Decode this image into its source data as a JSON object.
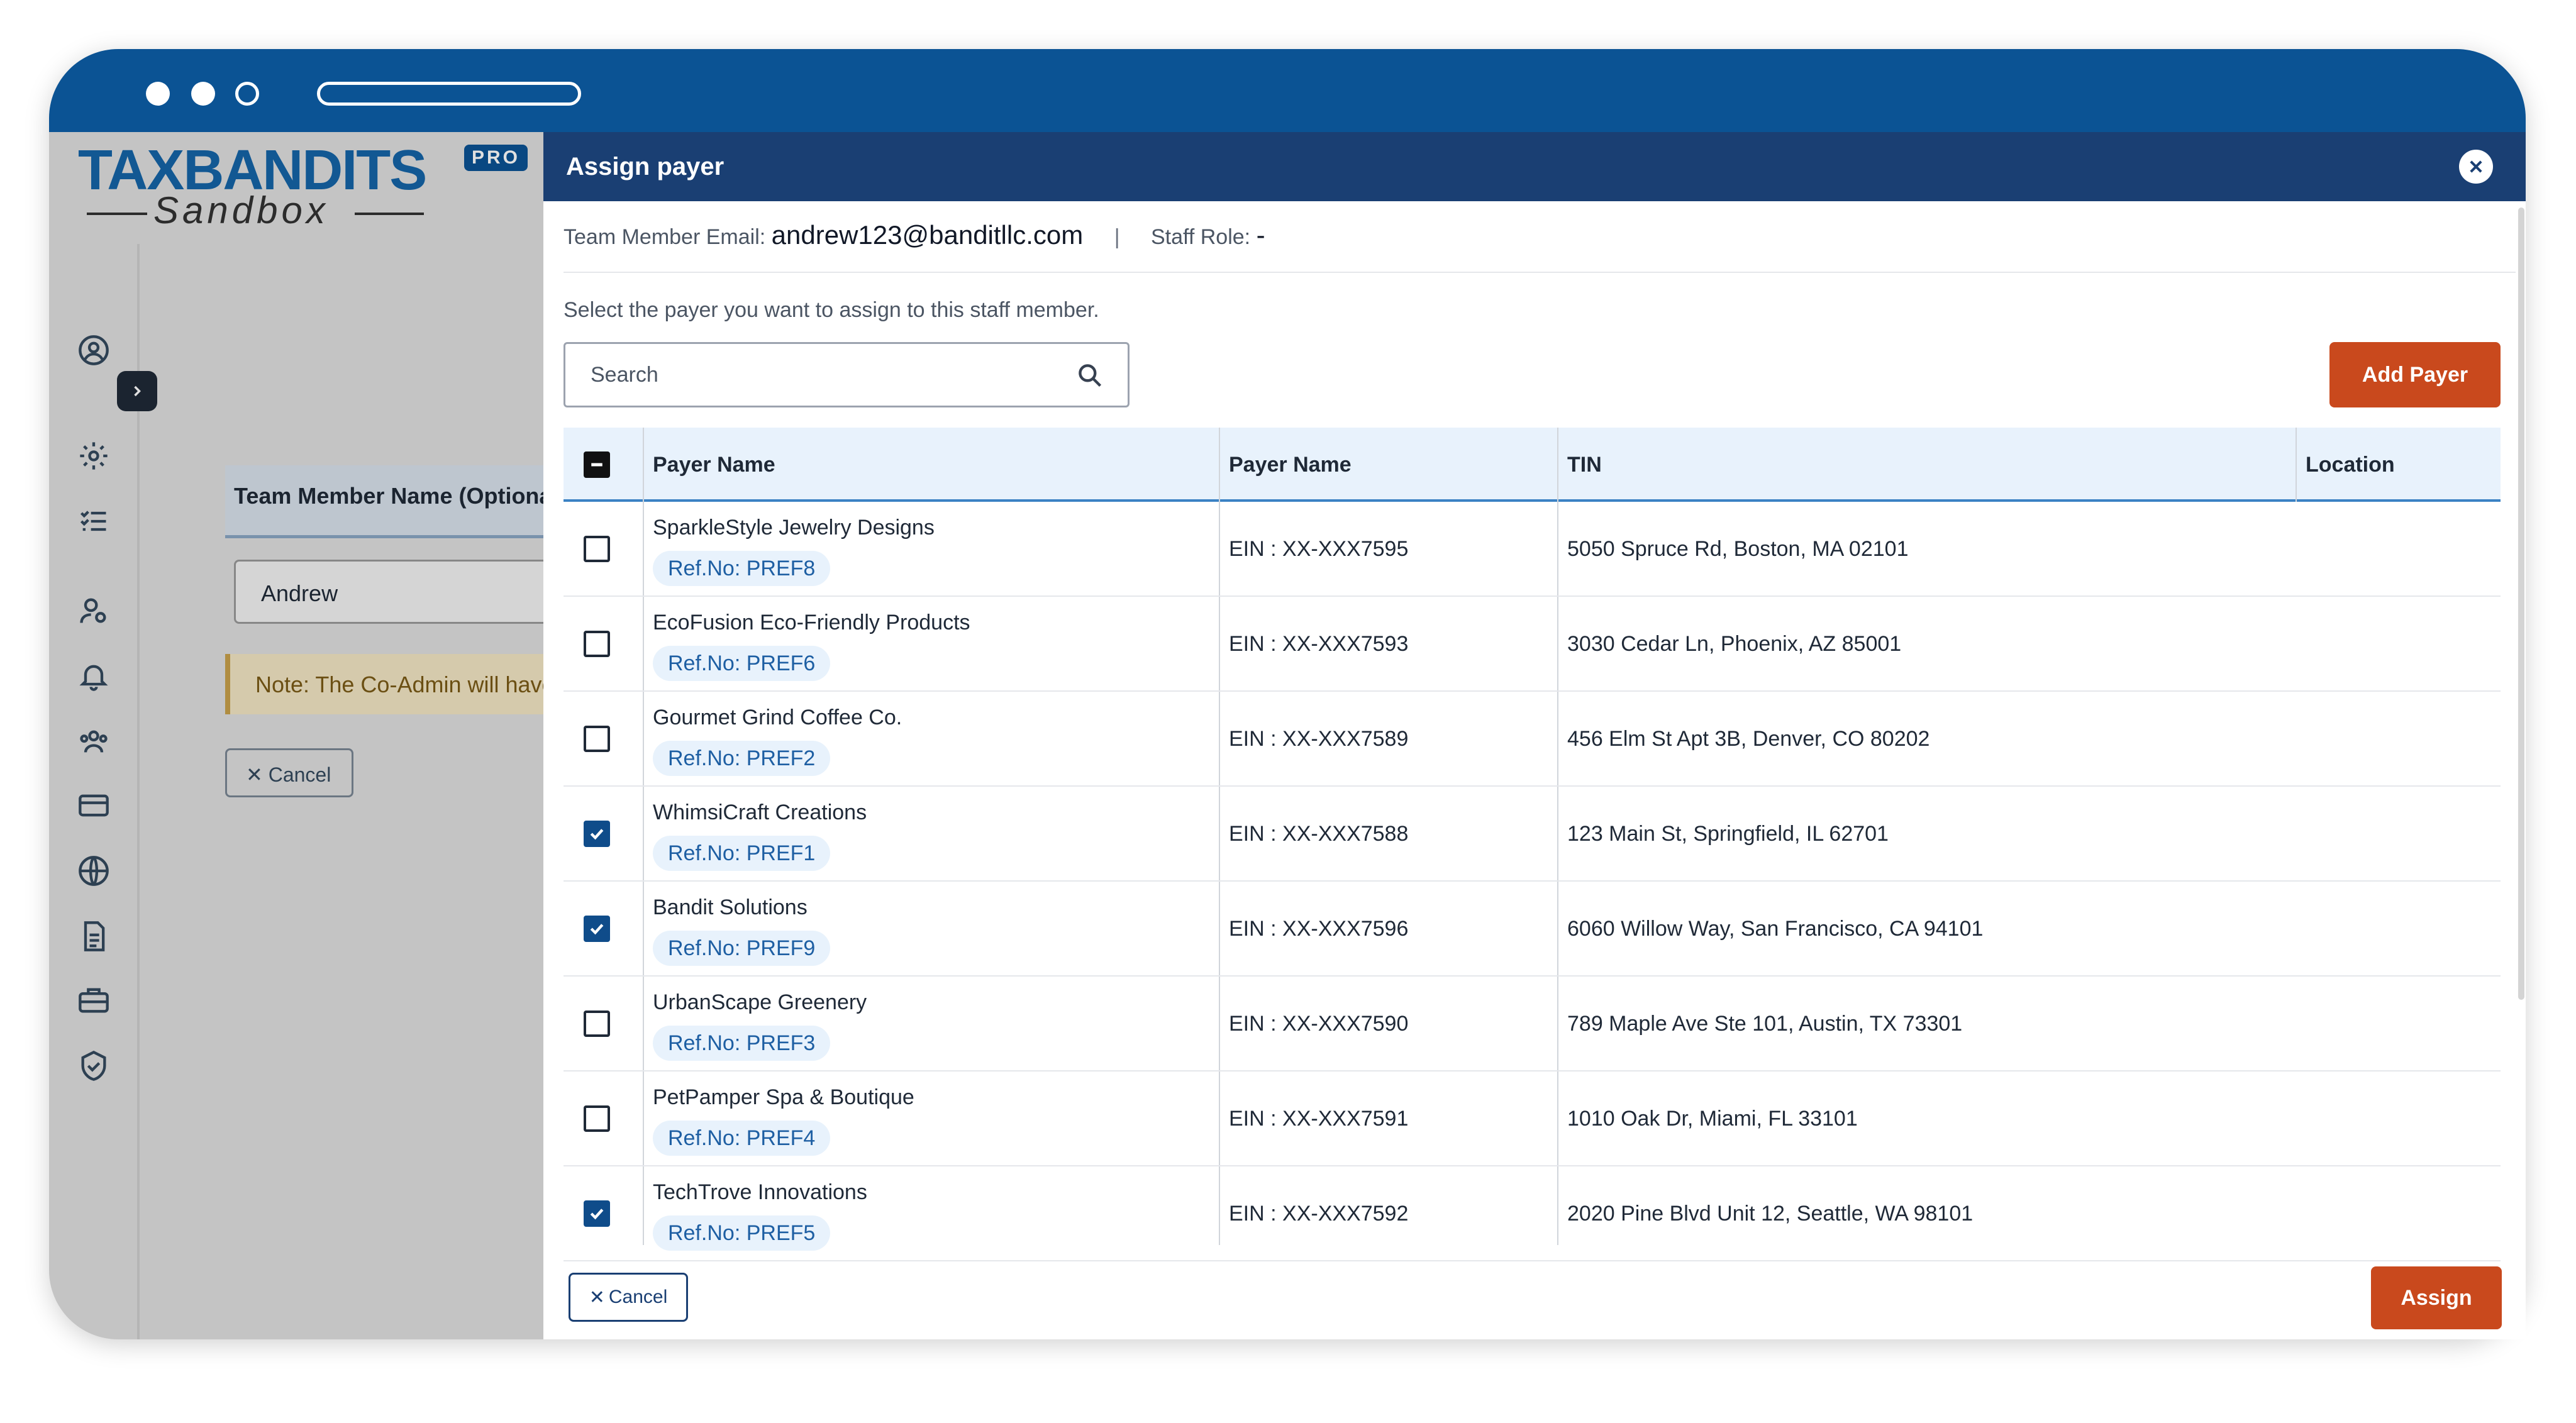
{
  "background": {
    "logo": {
      "main": "TAXBANDITS",
      "sub": "Sandbox",
      "badge": "PRO"
    },
    "field_label": "Team Member Name (Optional)",
    "field_value": "Andrew",
    "note": "Note: The Co-Admin will have",
    "cancel_label": "Cancel"
  },
  "modal": {
    "title": "Assign payer",
    "member_email_label": "Team Member Email:",
    "member_email": "andrew123@banditllc.com",
    "separator": "|",
    "staff_role_label": "Staff Role:",
    "staff_role": "-",
    "instruction": "Select the payer you want to assign to this staff member.",
    "search_placeholder": "Search",
    "add_payer_label": "Add Payer",
    "columns": [
      "Payer Name",
      "Payer Name",
      "TIN",
      "Location"
    ],
    "rows": [
      {
        "name": "SparkleStyle Jewelry Designs",
        "ref": "Ref.No: PREF8",
        "tin": "EIN : XX-XXX7595",
        "location": "5050 Spruce Rd, Boston, MA 02101",
        "checked": false
      },
      {
        "name": "EcoFusion Eco-Friendly Products",
        "ref": "Ref.No: PREF6",
        "tin": "EIN : XX-XXX7593",
        "location": "3030 Cedar Ln, Phoenix, AZ 85001",
        "checked": false
      },
      {
        "name": "Gourmet Grind Coffee Co.",
        "ref": "Ref.No: PREF2",
        "tin": "EIN : XX-XXX7589",
        "location": "456 Elm St Apt 3B, Denver, CO 80202",
        "checked": false
      },
      {
        "name": "WhimsiCraft Creations",
        "ref": "Ref.No: PREF1",
        "tin": "EIN : XX-XXX7588",
        "location": "123 Main St, Springfield, IL 62701",
        "checked": true
      },
      {
        "name": "Bandit Solutions",
        "ref": "Ref.No: PREF9",
        "tin": "EIN : XX-XXX7596",
        "location": "6060 Willow Way, San Francisco, CA 94101",
        "checked": true
      },
      {
        "name": "UrbanScape Greenery",
        "ref": "Ref.No: PREF3",
        "tin": "EIN : XX-XXX7590",
        "location": "789 Maple Ave Ste 101, Austin, TX 73301",
        "checked": false
      },
      {
        "name": "PetPamper Spa & Boutique",
        "ref": "Ref.No: PREF4",
        "tin": "EIN : XX-XXX7591",
        "location": "1010 Oak Dr, Miami, FL 33101",
        "checked": false
      },
      {
        "name": "TechTrove Innovations",
        "ref": "Ref.No: PREF5",
        "tin": "EIN : XX-XXX7592",
        "location": "2020 Pine Blvd Unit 12, Seattle, WA 98101",
        "checked": true
      }
    ],
    "cancel_label": "Cancel",
    "assign_label": "Assign"
  },
  "colors": {
    "chrome": "#0b5394",
    "modal_header": "#1a3f73",
    "accent": "#c9491d",
    "checkbox_checked": "#0f4c8a"
  }
}
